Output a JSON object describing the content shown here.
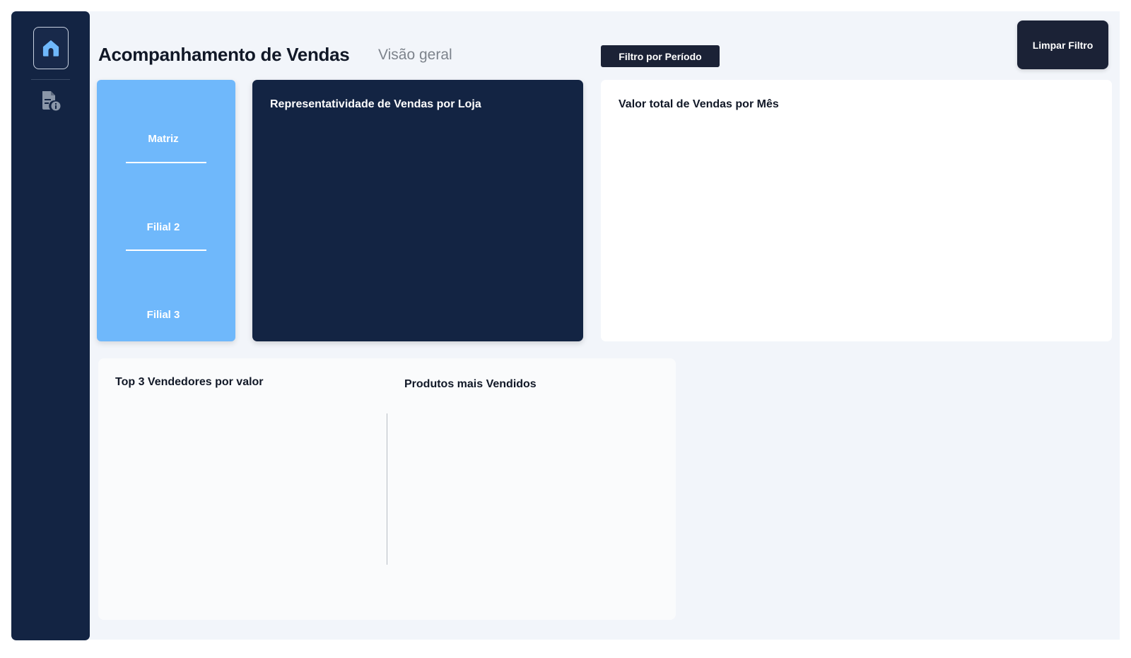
{
  "header": {
    "title": "Acompanhamento de Vendas",
    "subtitle": "Visão geral"
  },
  "sidebar": {
    "items": [
      {
        "name": "home",
        "icon": "home-icon",
        "active": true
      },
      {
        "name": "report",
        "icon": "report-info-icon",
        "active": false
      }
    ]
  },
  "filters": {
    "period_label": "Filtro por Período",
    "clear_label": "Limpar Filtro"
  },
  "stores": {
    "items": [
      "Matriz",
      "Filial 2",
      "Filial 3"
    ]
  },
  "cards": {
    "store_share_title": "Representatividade de Vendas por Loja",
    "monthly_total_title": "Valor total de Vendas por Mês",
    "top_sellers_title": "Top 3 Vendedores por valor",
    "top_products_title": "Produtos mais Vendidos"
  },
  "colors": {
    "navy": "#132443",
    "accent_blue": "#6fb8fb",
    "button_dark": "#1b2236",
    "background": "#f2f5fa"
  }
}
